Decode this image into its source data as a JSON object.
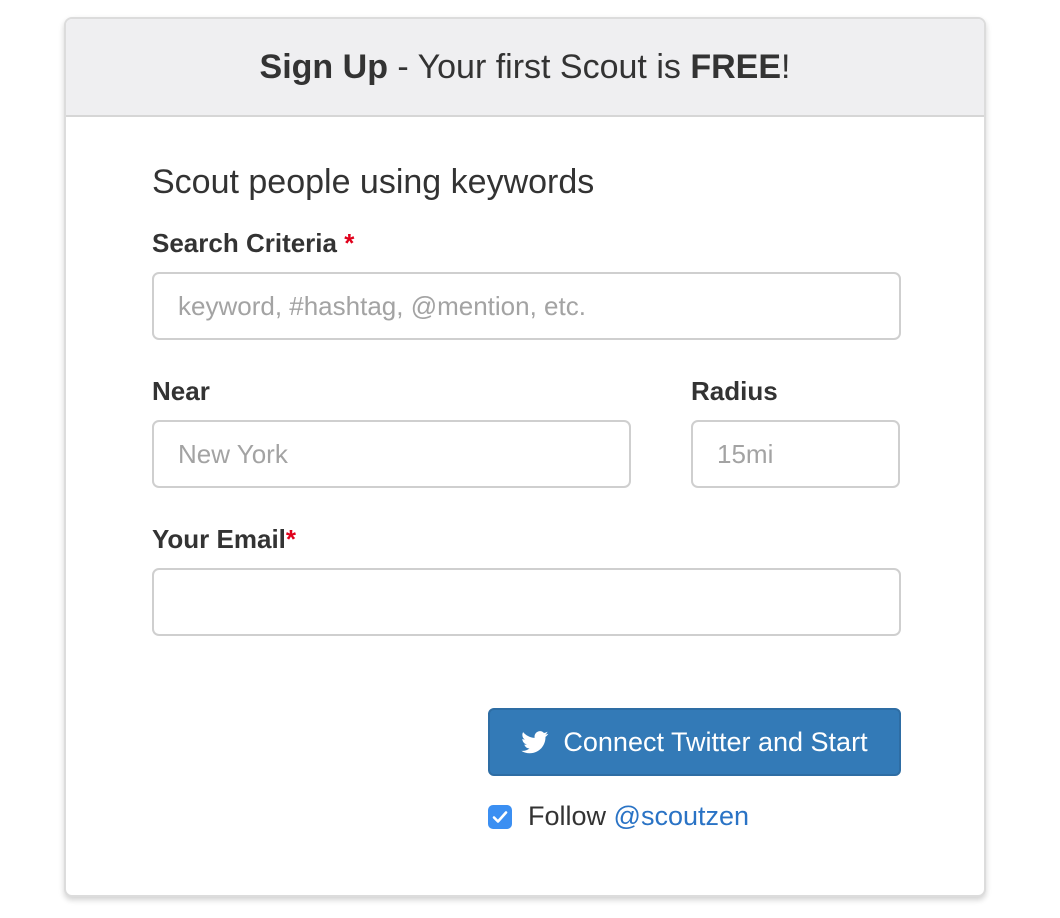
{
  "header": {
    "title_bold": "Sign Up",
    "title_mid": " - Your first Scout is ",
    "title_free": "FREE",
    "title_end": "!"
  },
  "form": {
    "section_title": "Scout people using keywords",
    "search": {
      "label": "Search Criteria",
      "required_mark": "*",
      "placeholder": "keyword, #hashtag, @mention, etc.",
      "value": ""
    },
    "near": {
      "label": "Near",
      "placeholder": "New York",
      "value": ""
    },
    "radius": {
      "label": "Radius",
      "placeholder": "15mi",
      "value": ""
    },
    "email": {
      "label": "Your Email",
      "required_mark": "*",
      "placeholder": "",
      "value": ""
    },
    "submit": {
      "label": "Connect Twitter and Start",
      "icon": "twitter-icon"
    },
    "follow": {
      "checked": true,
      "label": "Follow",
      "handle": "@scoutzen"
    }
  },
  "colors": {
    "primary": "#337ab7",
    "required": "#e0001b",
    "link": "#2a73c5",
    "checkbox": "#3b8ff2"
  }
}
